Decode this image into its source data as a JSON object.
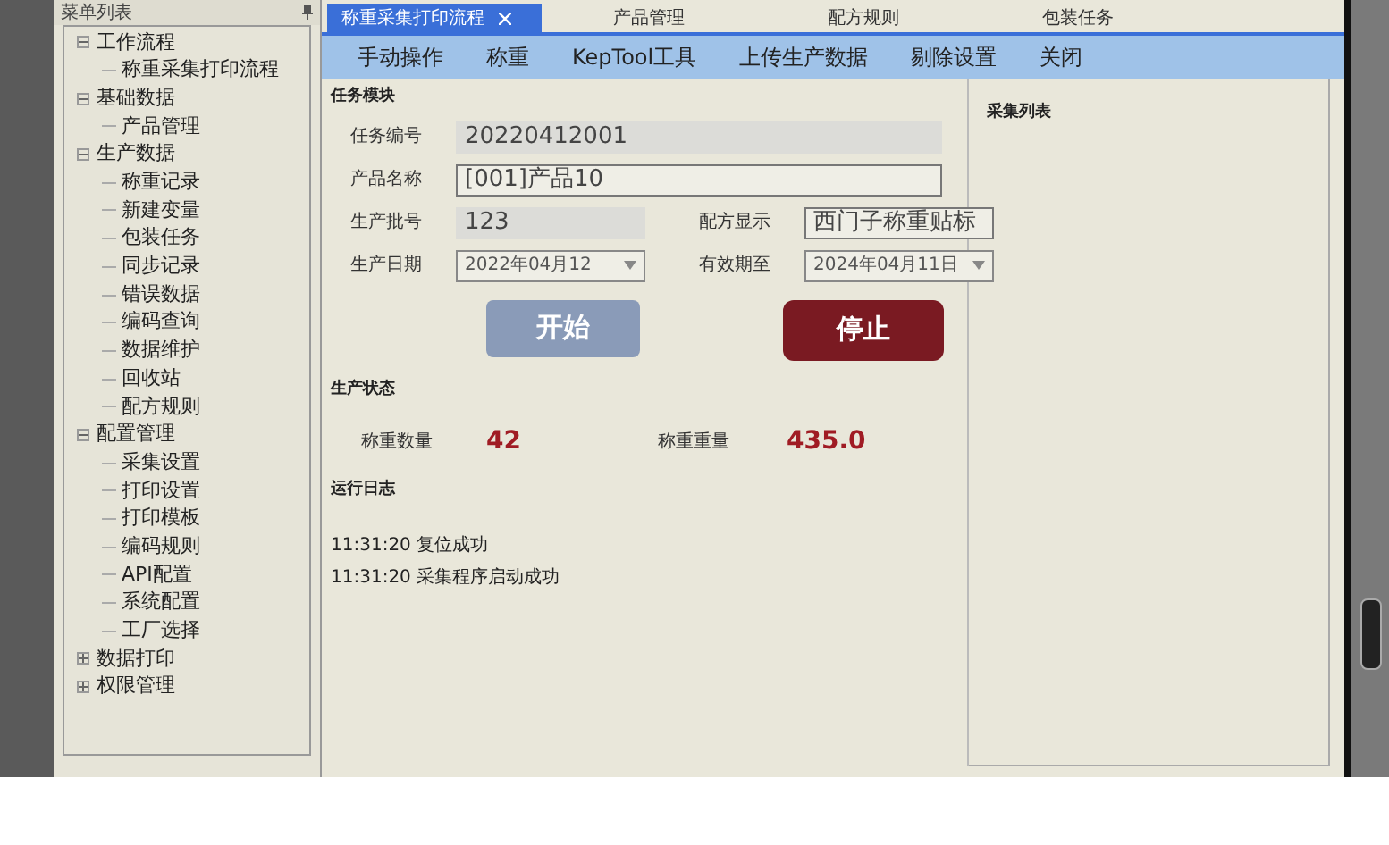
{
  "sidebar": {
    "title": "菜单列表",
    "items": [
      {
        "label": "工作流程",
        "expanded": true,
        "children": [
          {
            "label": "称重采集打印流程"
          }
        ]
      },
      {
        "label": "基础数据",
        "expanded": true,
        "children": [
          {
            "label": "产品管理"
          }
        ]
      },
      {
        "label": "生产数据",
        "expanded": true,
        "children": [
          {
            "label": "称重记录"
          },
          {
            "label": "新建变量"
          },
          {
            "label": "包装任务"
          },
          {
            "label": "同步记录"
          },
          {
            "label": "错误数据"
          },
          {
            "label": "编码查询"
          },
          {
            "label": "数据维护"
          },
          {
            "label": "回收站"
          },
          {
            "label": "配方规则"
          }
        ]
      },
      {
        "label": "配置管理",
        "expanded": true,
        "children": [
          {
            "label": "采集设置"
          },
          {
            "label": "打印设置"
          },
          {
            "label": "打印模板"
          },
          {
            "label": "编码规则"
          },
          {
            "label": "API配置"
          },
          {
            "label": "系统配置"
          },
          {
            "label": "工厂选择"
          }
        ]
      },
      {
        "label": "数据打印",
        "expanded": false
      },
      {
        "label": "权限管理",
        "expanded": false
      }
    ]
  },
  "tabs": [
    {
      "label": "称重采集打印流程",
      "selected": true
    },
    {
      "label": "产品管理",
      "selected": false
    },
    {
      "label": "配方规则",
      "selected": false
    },
    {
      "label": "包装任务",
      "selected": false
    }
  ],
  "toolbar": [
    "手动操作",
    "称重",
    "KepTool工具",
    "上传生产数据",
    "剔除设置",
    "关闭"
  ],
  "task": {
    "title": "任务模块",
    "task_no": {
      "label": "任务编号",
      "value": "20220412001"
    },
    "product": {
      "label": "产品名称",
      "value": "[001]产品10"
    },
    "batch": {
      "label": "生产批号",
      "value": "123"
    },
    "recipe": {
      "label": "配方显示",
      "value": "西门子称重贴标"
    },
    "prod_date": {
      "label": "生产日期",
      "value": "2022年04月12"
    },
    "expiry": {
      "label": "有效期至",
      "value": "2024年04月11日"
    },
    "start": "开始",
    "stop": "停止"
  },
  "status": {
    "title": "生产状态",
    "count_label": "称重数量",
    "count": "42",
    "weight_label": "称重重量",
    "weight": "435.0"
  },
  "log": {
    "title": "运行日志",
    "lines": [
      "11:31:20 复位成功",
      "11:31:20 采集程序启动成功"
    ]
  },
  "collect_list": {
    "title": "采集列表"
  }
}
